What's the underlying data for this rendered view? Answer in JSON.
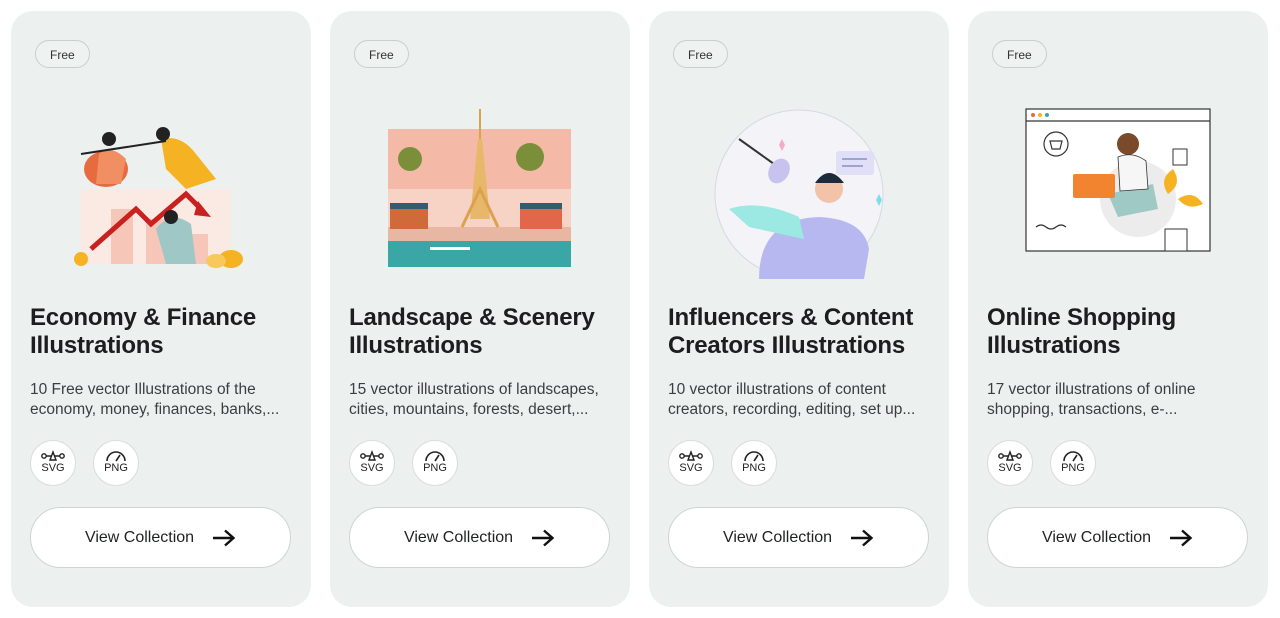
{
  "cards": [
    {
      "badge": "Free",
      "title_line1": "Economy & Finance",
      "title_line2": "Illustrations",
      "desc_line1": "10 Free vector Illustrations of the",
      "desc_line2": "economy, money, finances, banks,...",
      "format_svg": "SVG",
      "format_png": "PNG",
      "button": "View Collection",
      "illustration": "economy-finance-illustration"
    },
    {
      "badge": "Free",
      "title_line1": "Landscape & Scenery",
      "title_line2": "Illustrations",
      "desc_line1": "15 vector illustrations of landscapes,",
      "desc_line2": "cities, mountains, forests, desert,...",
      "format_svg": "SVG",
      "format_png": "PNG",
      "button": "View Collection",
      "illustration": "paris-landscape-illustration"
    },
    {
      "badge": "Free",
      "title_line1": "Influencers & Content",
      "title_line2": "Creators Illustrations",
      "desc_line1": "10 vector illustrations of content",
      "desc_line2": "creators, recording, editing, set up...",
      "format_svg": "SVG",
      "format_png": "PNG",
      "button": "View Collection",
      "illustration": "content-creator-illustration"
    },
    {
      "badge": "Free",
      "title_line1": "Online Shopping",
      "title_line2": "Illustrations",
      "desc_line1": "17 vector illustrations of online",
      "desc_line2": "shopping, transactions, e-...",
      "format_svg": "SVG",
      "format_png": "PNG",
      "button": "View Collection",
      "illustration": "online-shopping-illustration"
    }
  ],
  "icons": {
    "svg_format": "vector-pen-icon",
    "png_format": "gauge-icon",
    "button_arrow": "arrow-right-icon"
  },
  "colors": {
    "card_bg": "#ecf0ef",
    "button_bg": "#ffffff",
    "title": "#1b1d1e"
  }
}
